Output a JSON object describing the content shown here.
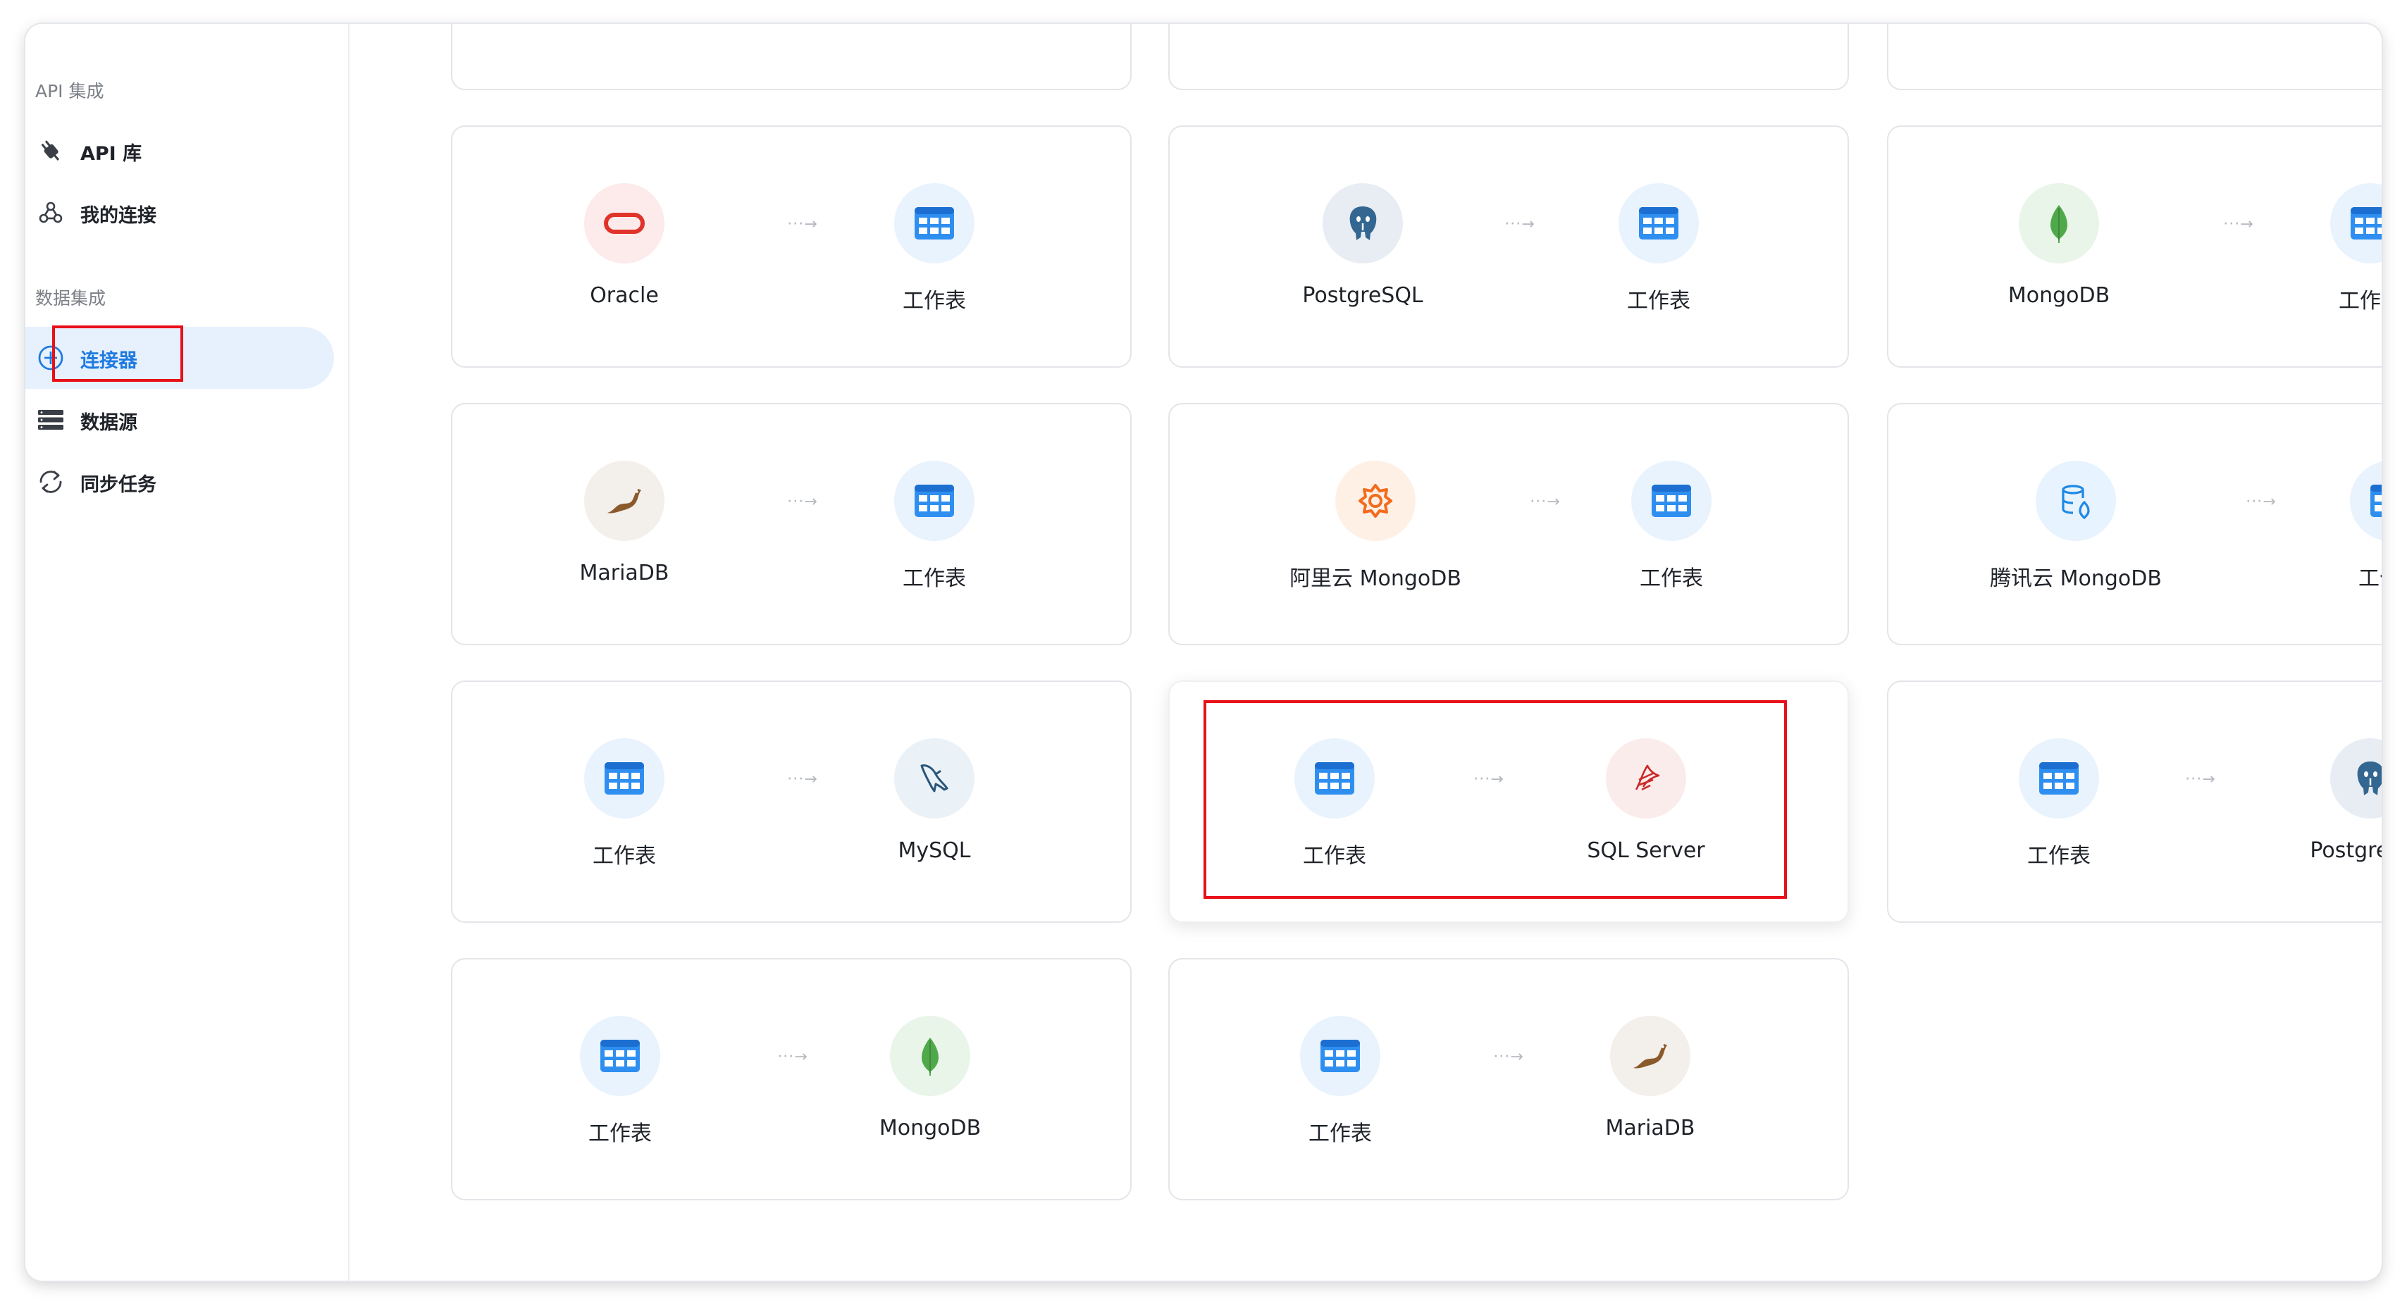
{
  "sidebar": {
    "api_section_title": "API 集成",
    "data_section_title": "数据集成",
    "items": [
      {
        "label": "API 库",
        "icon": "plug-icon"
      },
      {
        "label": "我的连接",
        "icon": "webhook-icon"
      },
      {
        "label": "连接器",
        "icon": "add-circle-icon",
        "active": true
      },
      {
        "label": "数据源",
        "icon": "database-list-icon"
      },
      {
        "label": "同步任务",
        "icon": "sync-icon"
      }
    ]
  },
  "arrow_glyph": "···→",
  "connectors": [
    {
      "source": "",
      "target": ""
    },
    {
      "source": "",
      "target": ""
    },
    {
      "source": "",
      "target": ""
    },
    {
      "source": "Oracle",
      "target": "工作表"
    },
    {
      "source": "PostgreSQL",
      "target": "工作表"
    },
    {
      "source": "MongoDB",
      "target": "工作表"
    },
    {
      "source": "MariaDB",
      "target": "工作表"
    },
    {
      "source": "阿里云 MongoDB",
      "target": "工作表"
    },
    {
      "source": "腾讯云 MongoDB",
      "target": "工作表"
    },
    {
      "source": "工作表",
      "target": "MySQL"
    },
    {
      "source": "工作表",
      "target": "SQL Server"
    },
    {
      "source": "工作表",
      "target": "PostgreSQL"
    },
    {
      "source": "工作表",
      "target": "MongoDB"
    },
    {
      "source": "工作表",
      "target": "MariaDB"
    }
  ],
  "colors": {
    "accent": "#1f7ae0",
    "active_bg": "#e6f1fd",
    "highlight_red": "#e8101a"
  }
}
